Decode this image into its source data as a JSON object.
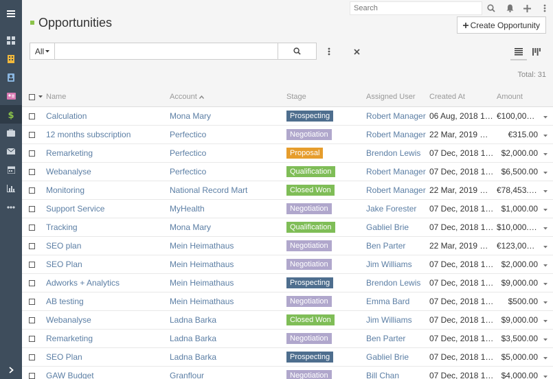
{
  "topbar": {
    "search_placeholder": "Search"
  },
  "page": {
    "title": "Opportunities",
    "create_label": "Create Opportunity",
    "total_label": "Total:",
    "total_value": "31"
  },
  "filter": {
    "select_label": "All",
    "value": ""
  },
  "colors": {
    "Prospecting": "#4e6e8e",
    "Negotiation": "#b0a7cc",
    "Proposal": "#e69d2c",
    "Qualification": "#7fbd57",
    "Closed Won": "#7fbd57"
  },
  "columns": [
    "Name",
    "Account",
    "Stage",
    "Assigned User",
    "Created At",
    "Amount"
  ],
  "rows": [
    {
      "name": "Calculation",
      "account": "Mona Mary",
      "stage": "Prospecting",
      "user": "Robert Manager",
      "created": "06 Aug, 2018 1…",
      "amount": "€100,000.00"
    },
    {
      "name": "12 months subscription",
      "account": "Perfectico",
      "stage": "Negotiation",
      "user": "Robert Manager",
      "created": "22 Mar, 2019 …",
      "amount": "€315.00"
    },
    {
      "name": "Remarketing",
      "account": "Perfectico",
      "stage": "Proposal",
      "user": "Brendon Lewis",
      "created": "07 Dec, 2018 1…",
      "amount": "$2,000.00"
    },
    {
      "name": "Webanalyse",
      "account": "Perfectico",
      "stage": "Qualification",
      "user": "Robert Manager",
      "created": "07 Dec, 2018 1…",
      "amount": "$6,500.00"
    },
    {
      "name": "Monitoring",
      "account": "National Record Mart",
      "stage": "Closed Won",
      "user": "Robert Manager",
      "created": "22 Mar, 2019 …",
      "amount": "€78,453.00"
    },
    {
      "name": "Support Service",
      "account": "MyHealth",
      "stage": "Negotiation",
      "user": "Jake Forester",
      "created": "07 Dec, 2018 1…",
      "amount": "$1,000.00"
    },
    {
      "name": "Tracking",
      "account": "Mona Mary",
      "stage": "Qualification",
      "user": "Gabliel Brie",
      "created": "07 Dec, 2018 1…",
      "amount": "$10,000.00"
    },
    {
      "name": "SEO plan",
      "account": "Mein Heimathaus",
      "stage": "Negotiation",
      "user": "Ben Parter",
      "created": "22 Mar, 2019 …",
      "amount": "€123,000.00"
    },
    {
      "name": "SEO Plan",
      "account": "Mein Heimathaus",
      "stage": "Negotiation",
      "user": "Jim Williams",
      "created": "07 Dec, 2018 1…",
      "amount": "$2,000.00"
    },
    {
      "name": "Adworks + Analytics",
      "account": "Mein Heimathaus",
      "stage": "Prospecting",
      "user": "Brendon Lewis",
      "created": "07 Dec, 2018 1…",
      "amount": "$9,000.00"
    },
    {
      "name": "AB testing",
      "account": "Mein Heimathaus",
      "stage": "Negotiation",
      "user": "Emma Bard",
      "created": "07 Dec, 2018 1…",
      "amount": "$500.00"
    },
    {
      "name": "Webanalyse",
      "account": "Ladna Barka",
      "stage": "Closed Won",
      "user": "Jim Williams",
      "created": "07 Dec, 2018 1…",
      "amount": "$9,000.00"
    },
    {
      "name": "Remarketing",
      "account": "Ladna Barka",
      "stage": "Negotiation",
      "user": "Ben Parter",
      "created": "07 Dec, 2018 1…",
      "amount": "$3,500.00"
    },
    {
      "name": "SEO Plan",
      "account": "Ladna Barka",
      "stage": "Prospecting",
      "user": "Gabliel Brie",
      "created": "07 Dec, 2018 1…",
      "amount": "$5,000.00"
    },
    {
      "name": "GAW Budget",
      "account": "Granflour",
      "stage": "Negotiation",
      "user": "Bill Chan",
      "created": "07 Dec, 2018 1…",
      "amount": "$4,000.00"
    }
  ]
}
